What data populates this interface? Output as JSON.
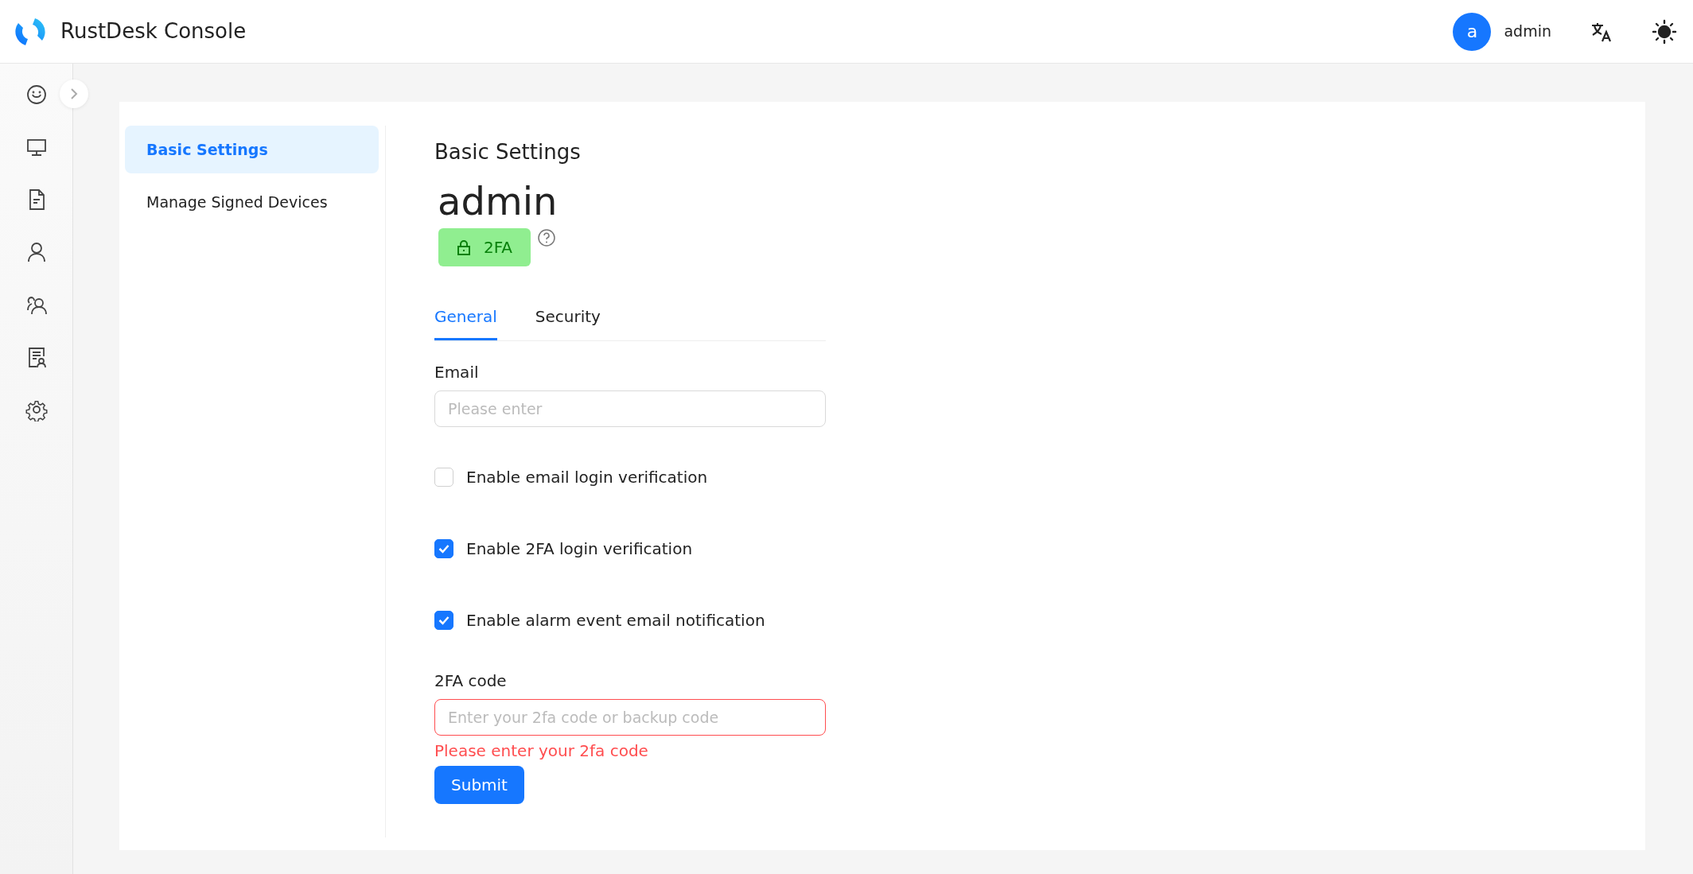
{
  "header": {
    "title": "RustDesk Console",
    "avatar_letter": "a",
    "username": "admin"
  },
  "settings_menu": [
    {
      "label": "Basic Settings",
      "selected": true
    },
    {
      "label": "Manage Signed Devices",
      "selected": false
    }
  ],
  "page": {
    "heading": "Basic Settings",
    "username": "admin",
    "badge": "2FA"
  },
  "tabs": [
    {
      "label": "General",
      "selected": true
    },
    {
      "label": "Security",
      "selected": false
    }
  ],
  "form": {
    "email": {
      "label": "Email",
      "placeholder": "Please enter"
    },
    "checkboxes": [
      {
        "label": "Enable email login verification",
        "checked": false
      },
      {
        "label": "Enable 2FA login verification",
        "checked": true
      },
      {
        "label": "Enable alarm event email notification",
        "checked": true
      }
    ],
    "code": {
      "label": "2FA code",
      "placeholder": "Enter your 2fa code or backup code",
      "error": "Please enter your 2fa code"
    },
    "submit": "Submit"
  }
}
